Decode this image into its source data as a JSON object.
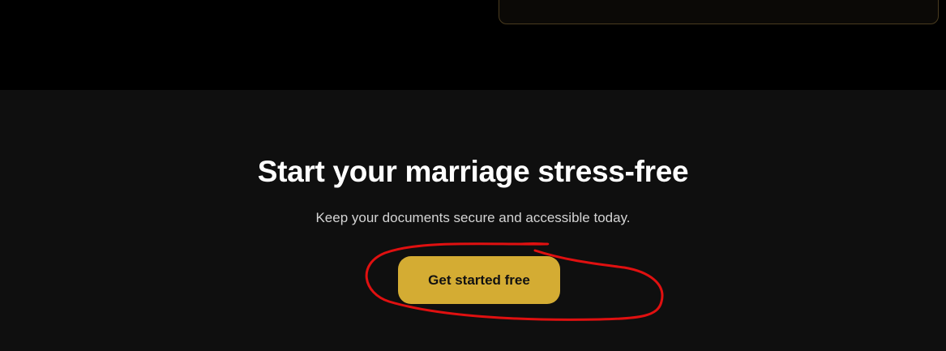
{
  "cta": {
    "title": "Start your marriage stress-free",
    "subtitle": "Keep your documents secure and accessible today.",
    "button_label": "Get started free"
  },
  "colors": {
    "page_background": "#000000",
    "section_background": "#0f0f0f",
    "accent": "#d4ac33",
    "annotation": "#e01010"
  }
}
